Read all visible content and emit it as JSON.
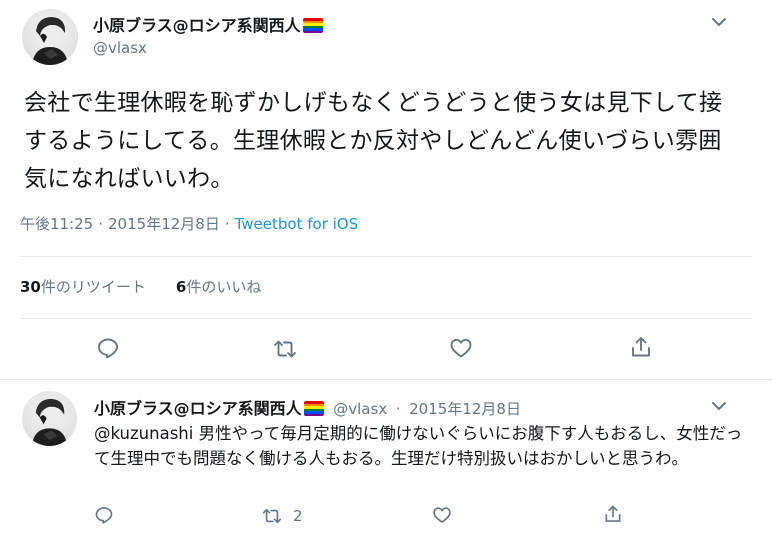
{
  "tweet": {
    "author_name": "小原ブラス@ロシア系関西人",
    "handle": "@vlasx",
    "text": "会社で生理休暇を恥ずかしげもなくどうどうと使う女は見下して接するようにしてる。生理休暇とか反対やしどんどん使いづらい雰囲気になればいいわ。",
    "time": "午後11:25",
    "date": "2015年12月8日",
    "separator": "·",
    "via": "Tweetbot for iOS",
    "retweet_count": "30",
    "retweet_label": "件のリツイート",
    "like_count": "6",
    "like_label": "件のいいね"
  },
  "reply": {
    "author_name": "小原ブラス@ロシア系関西人",
    "handle": "@vlasx",
    "separator": "·",
    "date": "2015年12月8日",
    "mention": "@kuzunashi",
    "text": " 男性やって毎月定期的に働けないぐらいにお腹下す人もおるし、女性だって生理中でも問題なく働ける人もおる。生理だけ特別扱いはおかしいと思うわ。",
    "retweet_count": "2"
  },
  "icons": {
    "reply": "reply-icon",
    "retweet": "retweet-icon",
    "like": "heart-icon",
    "share": "share-icon",
    "menu": "chevron-down-icon",
    "flag": "rainbow-flag-icon"
  },
  "colors": {
    "text": "#14171a",
    "secondary": "#657786",
    "link": "#1b95e0",
    "divider": "#e6ecf0"
  }
}
